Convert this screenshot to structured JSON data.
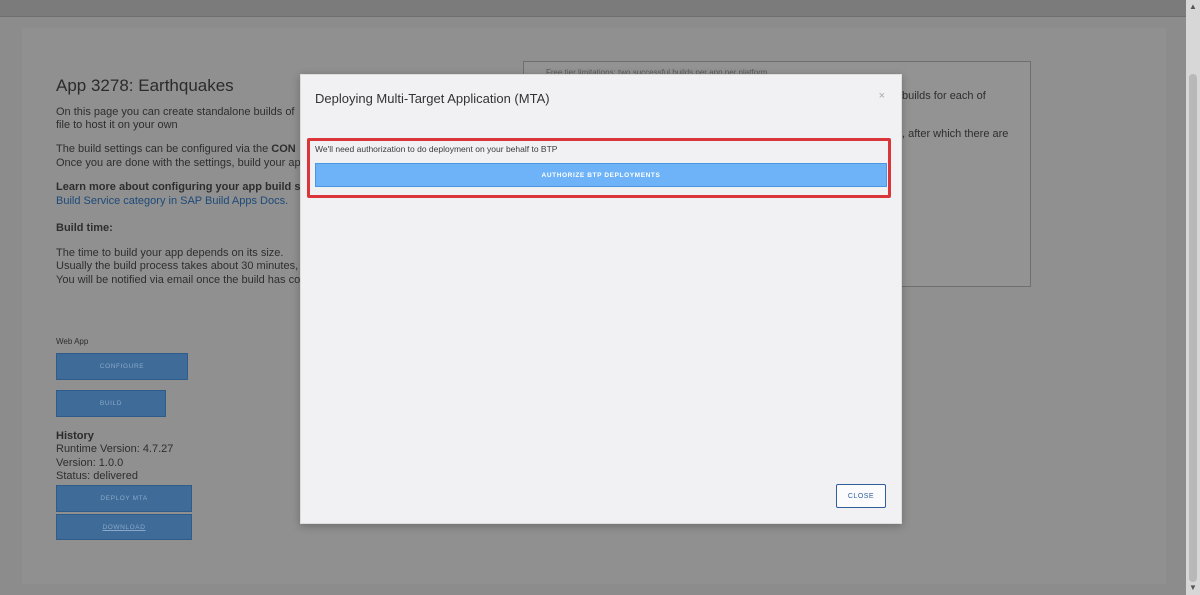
{
  "page": {
    "title": "App 3278: Earthquakes",
    "intro_line1": "On this page you can create standalone builds of",
    "intro_line2": "file to host it on your own",
    "settings_line1_pre": "The build settings can be configured via the ",
    "settings_line1_bold": "CON",
    "settings_line2": "Once you are done with the settings, build your ap",
    "learn_more_bold": "Learn more about configuring your app build sett",
    "learn_more_link": "Build Service category in SAP Build Apps Docs.",
    "build_time_title": "Build time:",
    "build_time_line1": "The time to build your app depends on its size.",
    "build_time_line2": "Usually the build process takes about 30 minutes,",
    "build_time_line3": "You will be notified via email once the build has co"
  },
  "right_box": {
    "line_top": "Free tier limitations: two successful builds per app per platform",
    "line1_tail": "builds for each of",
    "line2_tail": ", after which there are"
  },
  "web_app": {
    "section_label": "Web App",
    "configure_label": "CONFIGURE",
    "build_label": "BUILD"
  },
  "history": {
    "title": "History",
    "runtime_version": "Runtime Version: 4.7.27",
    "version": "Version: 1.0.0",
    "status": "Status: delivered",
    "deploy_label": "DEPLOY MTA",
    "download_label": "DOWNLOAD"
  },
  "modal": {
    "title": "Deploying Multi-Target Application (MTA)",
    "close_x": "×",
    "auth_message": "We'll need authorization to do deployment on your behalf to BTP",
    "authorize_label": "AUTHORIZE BTP DEPLOYMENTS",
    "close_label": "CLOSE"
  },
  "colors": {
    "highlight": "#d9353b",
    "primary_button": "#6eb3f7",
    "close_border": "#2f5f9b"
  }
}
